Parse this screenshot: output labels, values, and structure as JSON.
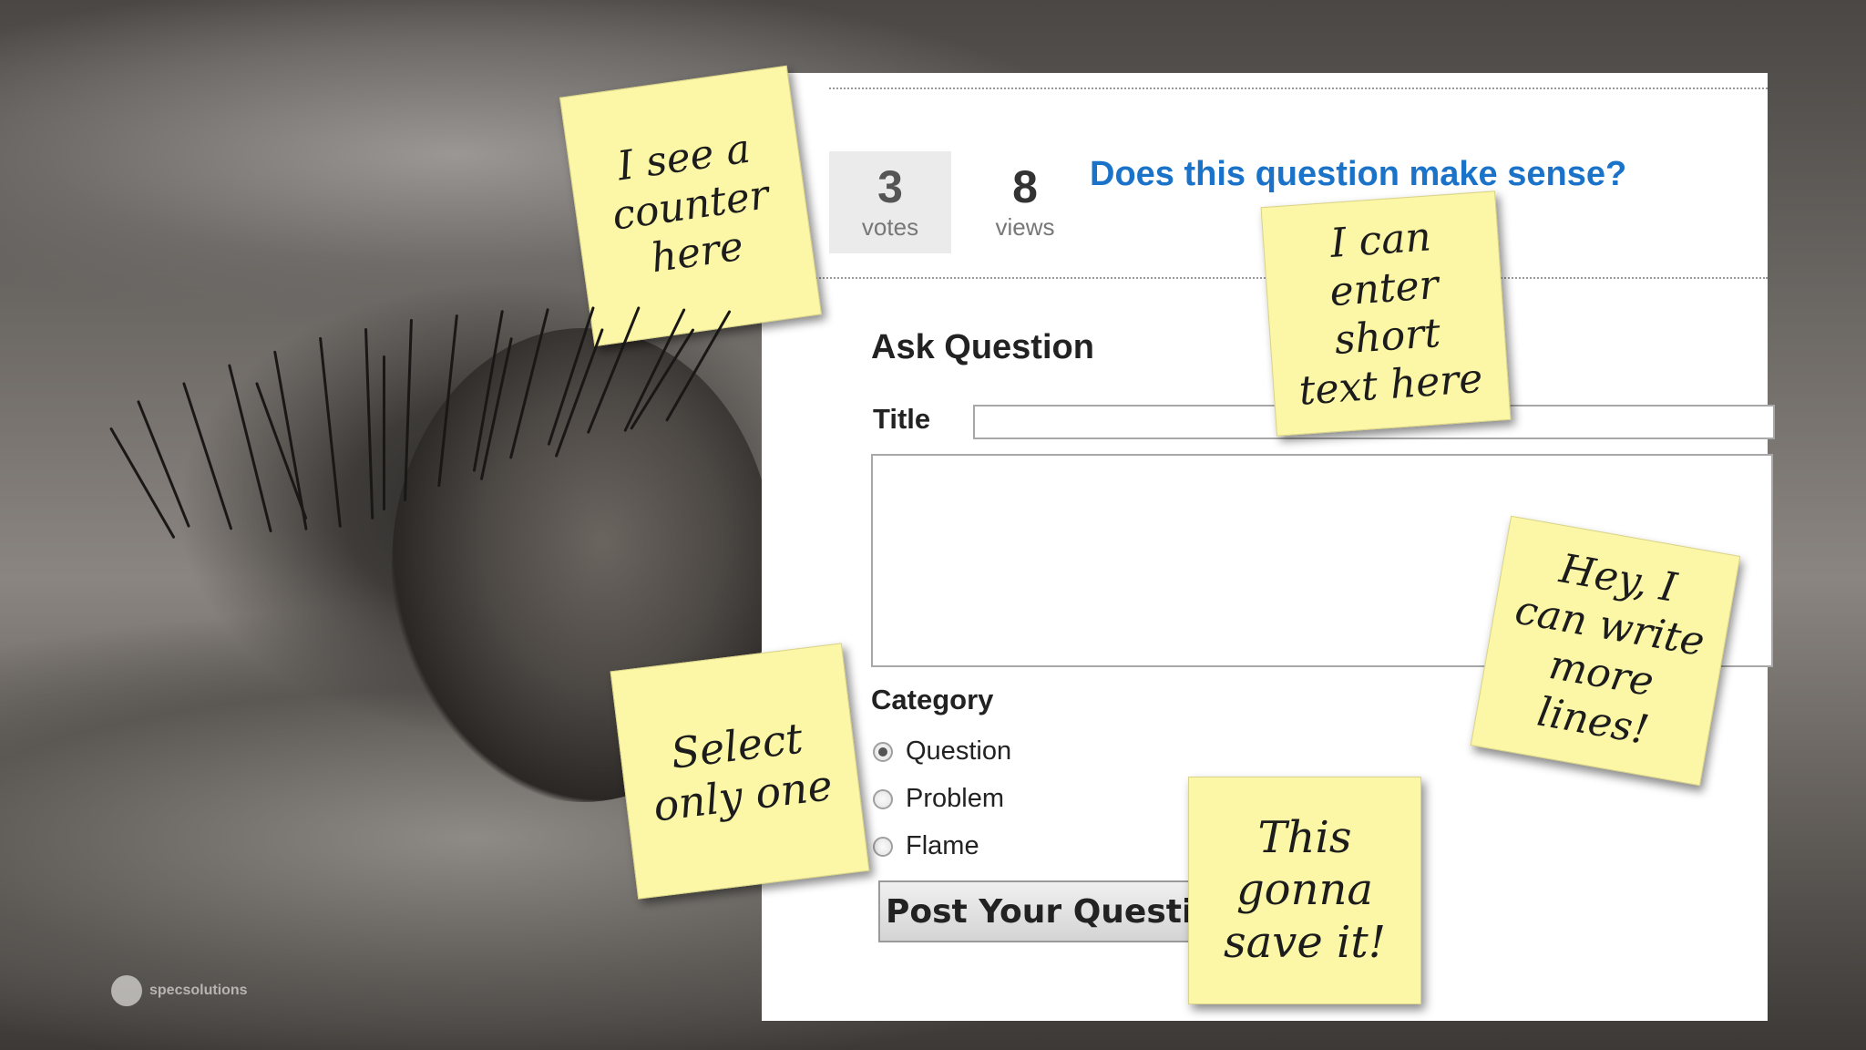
{
  "stats": {
    "votes_count": "3",
    "votes_label": "votes",
    "views_count": "8",
    "views_label": "views"
  },
  "question": {
    "link_text": "Does this question make sense?"
  },
  "form": {
    "heading": "Ask Question",
    "title_label": "Title",
    "title_value": "",
    "body_value": "",
    "category_label": "Category",
    "categories": [
      {
        "label": "Question",
        "checked": true
      },
      {
        "label": "Problem",
        "checked": false
      },
      {
        "label": "Flame",
        "checked": false
      }
    ],
    "submit_label": "Post Your Question"
  },
  "notes": {
    "counter": "I see a\ncounter\nhere",
    "short_text": "I can\nenter\nshort\ntext here",
    "more_lines": "Hey, I\ncan write\nmore\nlines!",
    "select_one": "Select\nonly one",
    "save_it": "This\ngonna\nsave it!"
  },
  "branding": {
    "logo_text": "specsolutions"
  },
  "colors": {
    "link": "#1a73c9",
    "note": "#fbf7a6",
    "vote_box": "#ebebeb"
  }
}
